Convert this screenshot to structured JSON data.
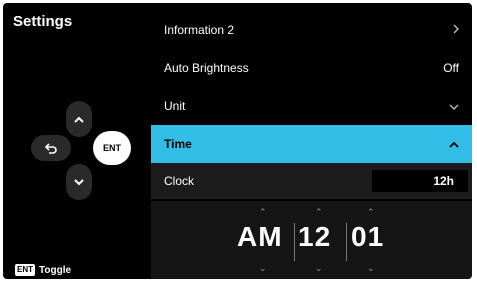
{
  "header": {
    "title": "Settings"
  },
  "dpad": {
    "ent_label": "ENT"
  },
  "footer": {
    "badge": "ENT",
    "hint": "Toggle"
  },
  "menu": {
    "info": {
      "label": "Information 2"
    },
    "auto_brightness": {
      "label": "Auto Brightness",
      "value": "Off"
    },
    "unit": {
      "label": "Unit"
    },
    "time": {
      "label": "Time"
    },
    "clock": {
      "label": "Clock",
      "value": "12h"
    }
  },
  "picker": {
    "period": "AM",
    "hour": "12",
    "minute": "01"
  },
  "colors": {
    "accent": "#32bde6",
    "background": "#000000"
  }
}
